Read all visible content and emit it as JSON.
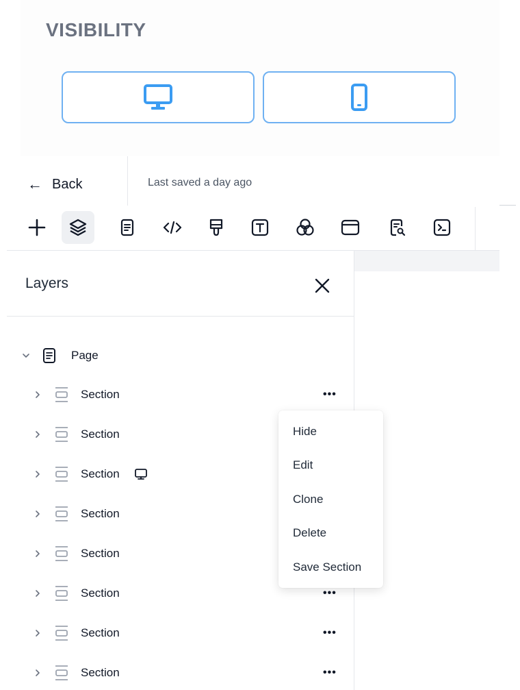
{
  "visibility": {
    "title": "VISIBILITY",
    "options": [
      {
        "name": "desktop",
        "icon": "desktop-icon",
        "color": "#3b9cf2"
      },
      {
        "name": "mobile",
        "icon": "mobile-icon",
        "color": "#3b9cf2"
      }
    ]
  },
  "header": {
    "back_label": "Back",
    "saved_text": "Last saved a day ago"
  },
  "toolbar": {
    "tools": [
      {
        "icon": "plus-icon",
        "active": false
      },
      {
        "icon": "layers-icon",
        "active": true
      },
      {
        "icon": "document-icon",
        "active": false
      },
      {
        "icon": "code-icon",
        "active": false
      },
      {
        "icon": "brush-icon",
        "active": false
      },
      {
        "icon": "text-icon",
        "active": false
      },
      {
        "icon": "color-circles-icon",
        "active": false
      },
      {
        "icon": "window-icon",
        "active": false
      },
      {
        "icon": "document-search-icon",
        "active": false
      },
      {
        "icon": "terminal-icon",
        "active": false
      }
    ]
  },
  "layers": {
    "title": "Layers",
    "root": {
      "label": "Page",
      "expanded": true
    },
    "sections": [
      {
        "label": "Section",
        "device_icon": false,
        "more": true
      },
      {
        "label": "Section",
        "device_icon": false,
        "more": false
      },
      {
        "label": "Section",
        "device_icon": true,
        "more": false
      },
      {
        "label": "Section",
        "device_icon": false,
        "more": false
      },
      {
        "label": "Section",
        "device_icon": false,
        "more": false
      },
      {
        "label": "Section",
        "device_icon": false,
        "more": true
      },
      {
        "label": "Section",
        "device_icon": false,
        "more": true
      },
      {
        "label": "Section",
        "device_icon": false,
        "more": true
      }
    ],
    "more_label": "•••"
  },
  "context_menu": {
    "items": [
      "Hide",
      "Edit",
      "Clone",
      "Delete",
      "Save Section"
    ]
  }
}
